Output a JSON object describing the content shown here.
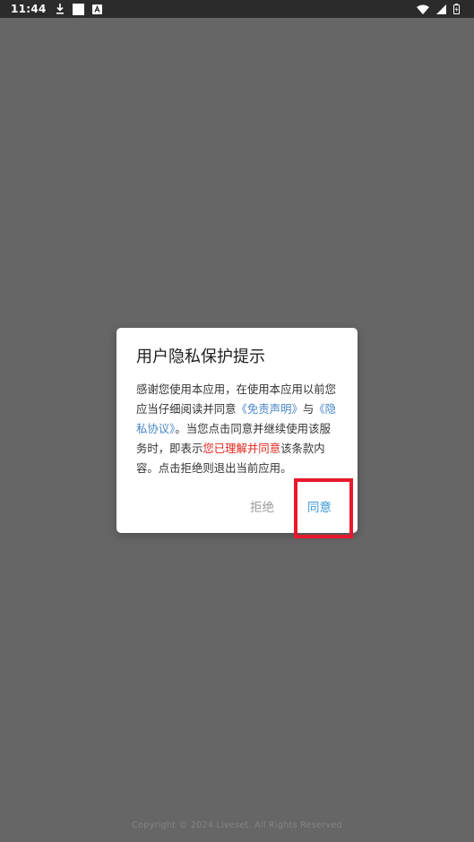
{
  "status_bar": {
    "time": "11:44",
    "left_icons": [
      "download-icon",
      "square-icon",
      "app-a-icon"
    ],
    "right_icons": [
      "wifi-icon",
      "signal-icon",
      "battery-icon"
    ]
  },
  "dialog": {
    "title": "用户隐私保护提示",
    "body": {
      "part1": "感谢您使用本应用，在使用本应用以前您应当仔细阅读并同意",
      "link_disclaimer": "《免责声明》",
      "part2": "与",
      "link_privacy": "《隐私协议》",
      "part3": "。当您点击同意并继续使用该服务时，即表示",
      "highlight": "您已理解并同意",
      "part4": "该条款内容。点击拒绝则退出当前应用。"
    },
    "reject_label": "拒绝",
    "agree_label": "同意"
  },
  "footer": {
    "copyright": "Copyright © 2024 Liveset. All Rights Reserved"
  },
  "colors": {
    "overlay": "#666666",
    "link": "#4a86c8",
    "highlight": "#e0241c",
    "agree": "#3a9ad9",
    "focus_box": "#e8192c"
  }
}
